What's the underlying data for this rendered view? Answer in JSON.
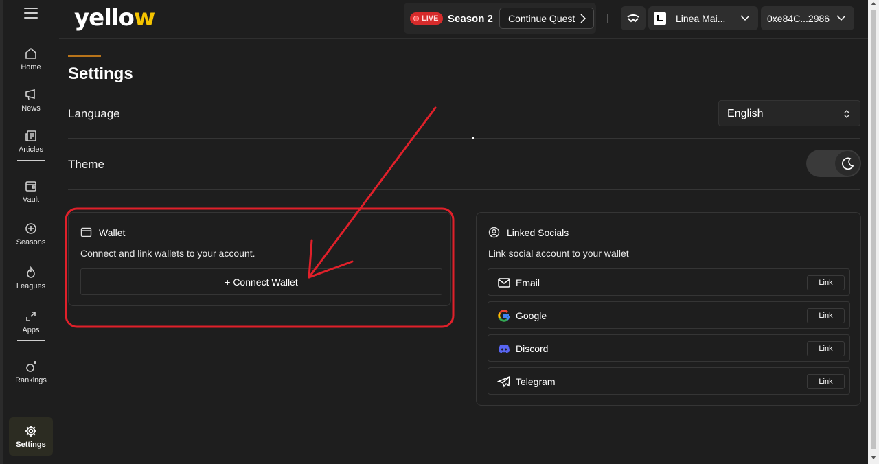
{
  "app": {
    "logo_text": "yell",
    "logo_o": "o",
    "logo_tail": "w"
  },
  "sidebar": {
    "items": [
      {
        "label": "Home",
        "icon": "home-icon"
      },
      {
        "label": "News",
        "icon": "megaphone-icon"
      },
      {
        "label": "Articles",
        "icon": "article-icon"
      },
      {
        "label": "Vault",
        "icon": "vault-icon"
      },
      {
        "label": "Seasons",
        "icon": "seasons-icon"
      },
      {
        "label": "Leagues",
        "icon": "flame-icon"
      },
      {
        "label": "Apps",
        "icon": "apps-icon"
      },
      {
        "label": "Rankings",
        "icon": "rankings-icon"
      },
      {
        "label": "Settings",
        "icon": "gear-icon",
        "active": true
      }
    ]
  },
  "header": {
    "live_label": "LIVE",
    "season_label": "Season 2",
    "quest_button": "Continue Quest",
    "network_label": "Linea Mai...",
    "address_label": "0xe84C...2986"
  },
  "page": {
    "title": "Settings",
    "language_label": "Language",
    "language_value": "English",
    "theme_label": "Theme"
  },
  "wallet": {
    "title": "Wallet",
    "description": "Connect and link wallets to your account.",
    "connect_button": "+ Connect Wallet"
  },
  "socials": {
    "title": "Linked Socials",
    "description": "Link social account to your wallet",
    "items": [
      {
        "name": "Email",
        "action": "Link",
        "icon": "mail-icon"
      },
      {
        "name": "Google",
        "action": "Link",
        "icon": "google-icon"
      },
      {
        "name": "Discord",
        "action": "Link",
        "icon": "discord-icon"
      },
      {
        "name": "Telegram",
        "action": "Link",
        "icon": "telegram-icon"
      }
    ]
  },
  "colors": {
    "accent": "#f5c400",
    "live_red": "#d62b2b",
    "title_accent": "#b8741a",
    "annotation_red": "#e0202a"
  }
}
